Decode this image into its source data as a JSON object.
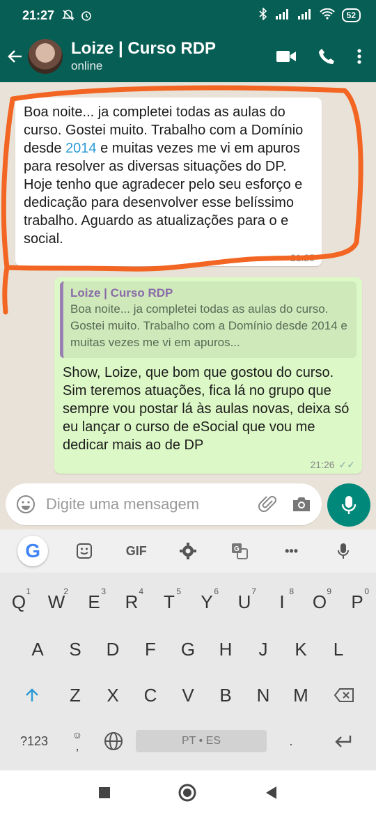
{
  "status_bar": {
    "time": "21:27",
    "battery": "52"
  },
  "header": {
    "name": "Loize | Curso RDP",
    "status": "online"
  },
  "messages": {
    "incoming": {
      "before_link": "Boa noite... ja completei todas as aulas do curso. Gostei muito. Trabalho com a Domínio desde ",
      "link": "2014",
      "after_link": " e muitas vezes me vi em apuros para resolver as diversas situações do DP.  Hoje tenho que agradecer pelo seu esforço e dedicação para desenvolver esse belíssimo trabalho. Aguardo as atualizações para o e social.",
      "time": "21:25"
    },
    "outgoing": {
      "quote_name": "Loize | Curso RDP",
      "quote_text": "Boa noite... ja completei todas as aulas do curso. Gostei muito. Trabalho com a Domínio desde 2014 e muitas vezes me vi em apuros...",
      "text": "Show, Loize, que bom que gostou do curso. Sim teremos atuações, fica lá no grupo que sempre vou postar lá às aulas novas, deixa só eu lançar o curso de eSocial que vou me dedicar mais ao de DP",
      "time": "21:26"
    }
  },
  "input": {
    "placeholder": "Digite uma mensagem"
  },
  "keyboard": {
    "toolbar_gif": "GIF",
    "toolbar_more": "•••",
    "google_label": "G",
    "row1": [
      {
        "k": "Q",
        "h": "1"
      },
      {
        "k": "W",
        "h": "2"
      },
      {
        "k": "E",
        "h": "3"
      },
      {
        "k": "R",
        "h": "4"
      },
      {
        "k": "T",
        "h": "5"
      },
      {
        "k": "Y",
        "h": "6"
      },
      {
        "k": "U",
        "h": "7"
      },
      {
        "k": "I",
        "h": "8"
      },
      {
        "k": "O",
        "h": "9"
      },
      {
        "k": "P",
        "h": "0"
      }
    ],
    "row2": [
      "A",
      "S",
      "D",
      "F",
      "G",
      "H",
      "J",
      "K",
      "L"
    ],
    "row3": [
      "Z",
      "X",
      "C",
      "V",
      "B",
      "N",
      "M"
    ],
    "symbols_label": "?123",
    "emoji_comma": ",",
    "space_label": "PT • ES",
    "period": "."
  },
  "colors": {
    "header": "#075e54",
    "outgoing_bubble": "#dcf8c6",
    "annotation": "#f26522",
    "send_button": "#00897b"
  }
}
